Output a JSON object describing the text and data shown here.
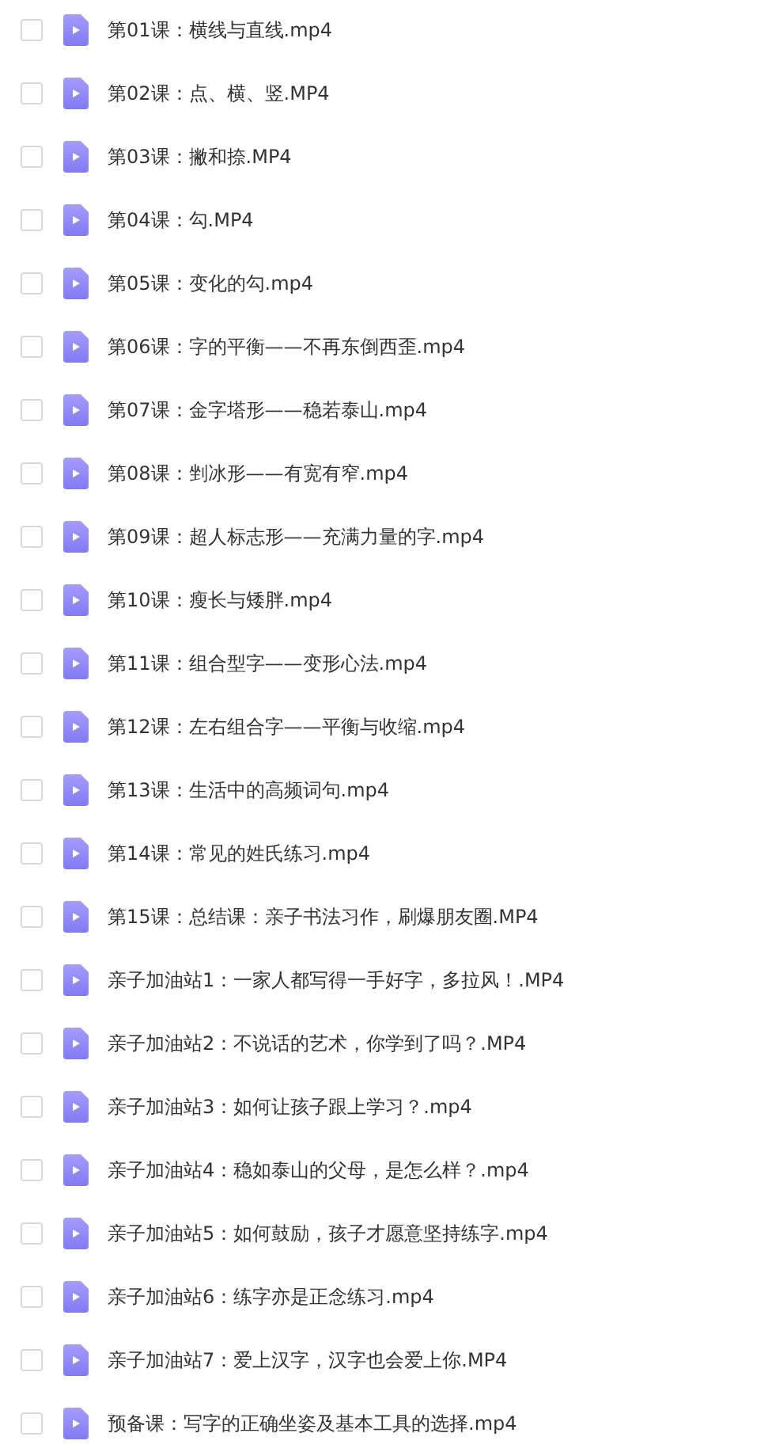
{
  "files": [
    {
      "name": "第01课：横线与直线.mp4",
      "checked": false
    },
    {
      "name": "第02课：点、横、竖.MP4",
      "checked": false
    },
    {
      "name": "第03课：撇和捺.MP4",
      "checked": false
    },
    {
      "name": "第04课：勾.MP4",
      "checked": false
    },
    {
      "name": "第05课：变化的勾.mp4",
      "checked": false
    },
    {
      "name": "第06课：字的平衡——不再东倒西歪.mp4",
      "checked": false
    },
    {
      "name": "第07课：金字塔形——稳若泰山.mp4",
      "checked": false
    },
    {
      "name": "第08课：剉冰形——有宽有窄.mp4",
      "checked": false
    },
    {
      "name": "第09课：超人标志形——充满力量的字.mp4",
      "checked": false
    },
    {
      "name": "第10课：瘦长与矮胖.mp4",
      "checked": false
    },
    {
      "name": "第11课：组合型字——变形心法.mp4",
      "checked": false
    },
    {
      "name": "第12课：左右组合字——平衡与收缩.mp4",
      "checked": false
    },
    {
      "name": "第13课：生活中的高频词句.mp4",
      "checked": false
    },
    {
      "name": "第14课：常见的姓氏练习.mp4",
      "checked": false
    },
    {
      "name": "第15课：总结课：亲子书法习作，刷爆朋友圈.MP4",
      "checked": false
    },
    {
      "name": "亲子加油站1：一家人都写得一手好字，多拉风！.MP4",
      "checked": false
    },
    {
      "name": "亲子加油站2：不说话的艺术，你学到了吗？.MP4",
      "checked": false
    },
    {
      "name": "亲子加油站3：如何让孩子跟上学习？.mp4",
      "checked": false
    },
    {
      "name": "亲子加油站4：稳如泰山的父母，是怎么样？.mp4",
      "checked": false
    },
    {
      "name": "亲子加油站5：如何鼓励，孩子才愿意坚持练字.mp4",
      "checked": false
    },
    {
      "name": "亲子加油站6：练字亦是正念练习.mp4",
      "checked": false
    },
    {
      "name": "亲子加油站7：爱上汉字，汉字也会爱上你.MP4",
      "checked": false
    },
    {
      "name": "预备课：写字的正确坐姿及基本工具的选择.mp4",
      "checked": false
    }
  ]
}
